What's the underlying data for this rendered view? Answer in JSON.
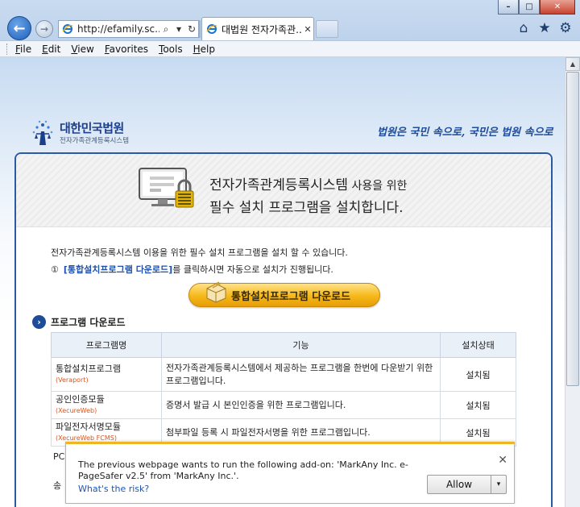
{
  "window": {
    "minimize": "–",
    "maximize": "□",
    "close": "✕"
  },
  "nav": {
    "back": "←",
    "forward": "→"
  },
  "address": {
    "url": "http://efamily.sc...",
    "search_icon": "⌕",
    "refresh_icon": "↻"
  },
  "tab": {
    "title": "대법원 전자가족관...",
    "close": "✕"
  },
  "toolbar_icons": {
    "home": "⌂",
    "favorites": "★",
    "tools": "⚙"
  },
  "menu": [
    "File",
    "Edit",
    "View",
    "Favorites",
    "Tools",
    "Help"
  ],
  "header": {
    "logo_name": "대한민국법원",
    "logo_sub": "전자가족관계등록시스템",
    "slogan": "법원은 국민 속으로, 국민은 법원 속으로"
  },
  "hero": {
    "line1_main": "전자가족관계등록시스템",
    "line1_tail": " 사용을 위한",
    "line2": "필수 설치 프로그램을 설치합니다."
  },
  "intro": {
    "text1": "전자가족관계등록시스템 이용을 위한 필수 설치 프로그램을 설치 할 수 있습니다.",
    "num": "①",
    "link": "[통합설치프로그램 다운로드]",
    "text2": "를 클릭하시면 자동으로 설치가 진행됩니다."
  },
  "download_button": "통합설치프로그램 다운로드",
  "section_title": "프로그램 다운로드",
  "table": {
    "headers": [
      "프로그램명",
      "기능",
      "설치상태"
    ],
    "rows": [
      {
        "name": "통합설치프로그램",
        "sub": "(Veraport)",
        "func": "전자가족관계등록시스템에서 제공하는 프로그램을 한번에 다운받기 위한 프로그램입니다.",
        "status": "설치됨"
      },
      {
        "name": "공인인증모듈",
        "sub": "(XecureWeb)",
        "func": "증명서 발급 시 본인인증을 위한 프로그램입니다.",
        "status": "설치됨"
      },
      {
        "name": "파일전자서명모듈",
        "sub": "(XecureWeb FCMS)",
        "func": "첨부파일 등록 시 파일전자서명을 위한 프로그램입니다.",
        "status": "설치됨"
      }
    ],
    "partial": [
      "PC",
      "송"
    ]
  },
  "notification": {
    "message": "The previous webpage wants to run the following add-on: 'MarkAny Inc. e-PageSafer v2.5' from 'MarkAny Inc.'.",
    "risk_link": "What's the risk?",
    "allow": "Allow",
    "dropdown": "▾",
    "close": "✕"
  }
}
